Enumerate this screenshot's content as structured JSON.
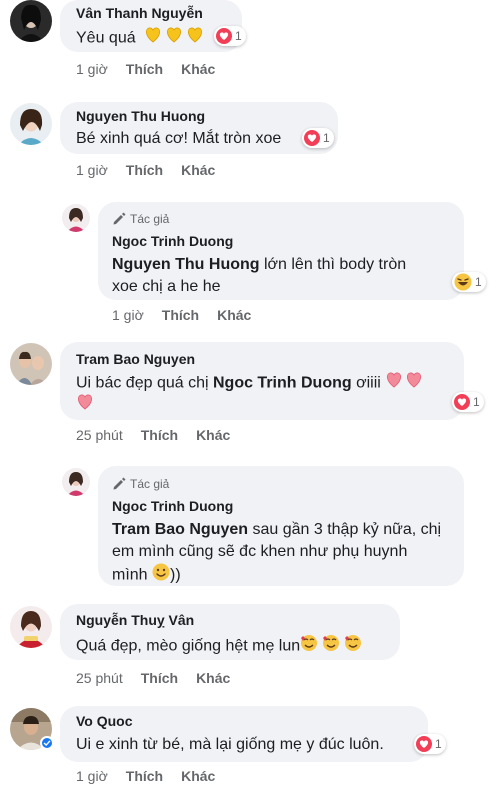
{
  "comments": [
    {
      "name": "Vân Thanh Nguyễn",
      "text": "Yêu quá",
      "reaction_count": "1",
      "time": "1 giờ",
      "like": "Thích",
      "more": "Khác"
    },
    {
      "name": "Nguyen Thu Huong",
      "text": "Bé xinh quá cơ! Mắt tròn xoe",
      "reaction_count": "1",
      "time": "1 giờ",
      "like": "Thích",
      "more": "Khác"
    },
    {
      "author_tag": "Tác giả",
      "name": "Ngoc Trinh Duong",
      "mention": "Nguyen Thu Huong",
      "text_line1": " lớn lên thì body tròn",
      "text_line2": "xoe chị a he he",
      "reaction_count": "1",
      "time": "1 giờ",
      "like": "Thích",
      "more": "Khác"
    },
    {
      "name": "Tram Bao Nguyen",
      "text_pre": "Ui bác đẹp quá chị ",
      "mention": "Ngoc Trinh Duong",
      "text_post": " ơiiii",
      "reaction_count": "1",
      "time": "25 phút",
      "like": "Thích",
      "more": "Khác"
    },
    {
      "author_tag": "Tác giả",
      "name": "Ngoc Trinh Duong",
      "mention": "Tram Bao Nguyen",
      "text_line1": " sau gần 3 thập kỷ nữa, chị",
      "text_line2": "em mình cũng sẽ đc khen như phụ huynh",
      "text_line3": "mình",
      "text_line3_end": "))"
    },
    {
      "name": "Nguyễn Thuỵ Vân",
      "text": "Quá đẹp, mèo giống hệt mẹ lun",
      "time": "25 phút",
      "like": "Thích",
      "more": "Khác"
    },
    {
      "name": "Vo Quoc",
      "text": "Ui e xinh từ bé, mà lại giống mẹ y đúc luôn.",
      "reaction_count": "1",
      "time": "1 giờ",
      "like": "Thích",
      "more": "Khác"
    }
  ],
  "icons": {
    "reaction": "heart-icon",
    "author": "pencil-icon",
    "verified": "verified-badge-icon"
  },
  "colors": {
    "bubble": "#f0f2f5",
    "heart": "#f33e58",
    "secondary_text": "#65676b"
  }
}
